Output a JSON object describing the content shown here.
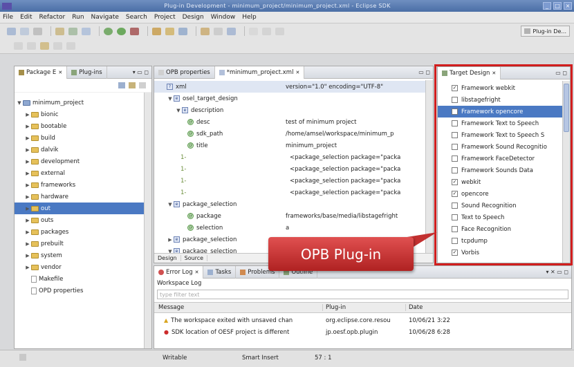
{
  "window": {
    "title": "Plug-in Development - minimum_project/minimum_project.xml - Eclipse SDK",
    "controls": [
      "_",
      "□",
      "×"
    ]
  },
  "menu": [
    "File",
    "Edit",
    "Refactor",
    "Run",
    "Navigate",
    "Search",
    "Project",
    "Design",
    "Window",
    "Help"
  ],
  "perspective": {
    "label": "Plug-in De..."
  },
  "package_explorer": {
    "tabs": [
      "Package E",
      "Plug-ins"
    ],
    "root": "minimum_project",
    "items": [
      "bionic",
      "bootable",
      "build",
      "dalvik",
      "development",
      "external",
      "frameworks",
      "hardware",
      "out",
      "outs",
      "packages",
      "prebuilt",
      "system",
      "vendor",
      "Makefile",
      "OPD properties"
    ],
    "selected": "out"
  },
  "editor": {
    "tabs": [
      "OPB properties",
      "*minimum_project.xml"
    ],
    "rows": [
      {
        "name": "xml",
        "value": "version=\"1.0\" encoding=\"UTF-8\""
      },
      {
        "name": "osel_target_design",
        "value": ""
      },
      {
        "name": "description",
        "value": ""
      },
      {
        "name": "desc",
        "value": "test of minimum project"
      },
      {
        "name": "sdk_path",
        "value": "/home/amsel/workspace/minimum_p"
      },
      {
        "name": "title",
        "value": "minimum_project"
      },
      {
        "name": "",
        "value": "<package_selection package=\"packa"
      },
      {
        "name": "",
        "value": "<package_selection package=\"packa"
      },
      {
        "name": "",
        "value": "<package_selection package=\"packa"
      },
      {
        "name": "",
        "value": "<package_selection package=\"packa"
      },
      {
        "name": "package_selection",
        "value": ""
      },
      {
        "name": "package",
        "value": "frameworks/base/media/libstagefright"
      },
      {
        "name": "selection",
        "value": "a"
      },
      {
        "name": "package_selection",
        "value": ""
      },
      {
        "name": "package_selection",
        "value": ""
      }
    ],
    "bottom_tabs": [
      "Design",
      "Source"
    ]
  },
  "target_design": {
    "tab": "Target Design",
    "items": [
      {
        "label": "Framework webkit",
        "checked": true
      },
      {
        "label": "libstagefright",
        "checked": false
      },
      {
        "label": "Framework opencore",
        "checked": true,
        "selected": true
      },
      {
        "label": "Framework Text to Speech",
        "checked": false
      },
      {
        "label": "Framework Text to Speech S",
        "checked": false
      },
      {
        "label": "Framework Sound Recognitio",
        "checked": false
      },
      {
        "label": "Framework FaceDetector",
        "checked": false
      },
      {
        "label": "Framework Sounds Data",
        "checked": false
      },
      {
        "label": "webkit",
        "checked": true
      },
      {
        "label": "opencore",
        "checked": true
      },
      {
        "label": "Sound Recognition",
        "checked": false
      },
      {
        "label": "Text to Speech",
        "checked": false
      },
      {
        "label": "Face Recognition",
        "checked": false
      },
      {
        "label": "tcpdump",
        "checked": false
      },
      {
        "label": "Vorbis",
        "checked": true
      }
    ]
  },
  "callout": {
    "text": "OPB Plug-in"
  },
  "error_log": {
    "tabs": [
      "Error Log",
      "Tasks",
      "Problems",
      "Outline"
    ],
    "workspace_label": "Workspace Log",
    "filter_placeholder": "type filter text",
    "columns": [
      "Message",
      "Plug-in",
      "Date"
    ],
    "rows": [
      {
        "message": "The workspace exited with unsaved chan",
        "plugin": "org.eclipse.core.resou",
        "date": "10/06/21 3:22"
      },
      {
        "message": "SDK location of OESF project is different",
        "plugin": "jp.oesf.opb.plugin",
        "date": "10/06/28 6:28"
      }
    ]
  },
  "status": {
    "writable": "Writable",
    "insert": "Smart Insert",
    "position": "57 : 1"
  }
}
